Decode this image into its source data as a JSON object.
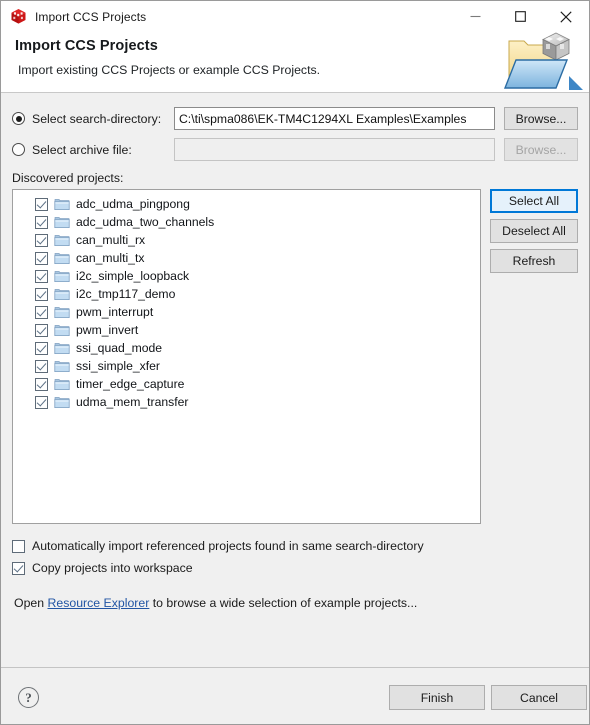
{
  "window": {
    "title": "Import CCS Projects",
    "icon": "ccs-cube-icon",
    "controls": {
      "minimize": "minimize-icon",
      "maximize": "maximize-icon",
      "close": "close-icon"
    }
  },
  "header": {
    "title": "Import CCS Projects",
    "subtitle": "Import existing CCS Projects or example CCS Projects.",
    "art": "import-projects-banner-icon"
  },
  "source": {
    "search_directory": {
      "label": "Select search-directory:",
      "selected": true,
      "value": "C:\\ti\\spma086\\EK-TM4C1294XL Examples\\Examples",
      "browse_label": "Browse...",
      "browse_enabled": true
    },
    "archive_file": {
      "label": "Select archive file:",
      "selected": false,
      "value": "",
      "placeholder": "",
      "browse_label": "Browse...",
      "browse_enabled": false
    }
  },
  "discovered": {
    "label": "Discovered projects:",
    "projects": [
      {
        "name": "adc_udma_pingpong",
        "checked": true
      },
      {
        "name": "adc_udma_two_channels",
        "checked": true
      },
      {
        "name": "can_multi_rx",
        "checked": true
      },
      {
        "name": "can_multi_tx",
        "checked": true
      },
      {
        "name": "i2c_simple_loopback",
        "checked": true
      },
      {
        "name": "i2c_tmp117_demo",
        "checked": true
      },
      {
        "name": "pwm_interrupt",
        "checked": true
      },
      {
        "name": "pwm_invert",
        "checked": true
      },
      {
        "name": "ssi_quad_mode",
        "checked": true
      },
      {
        "name": "ssi_simple_xfer",
        "checked": true
      },
      {
        "name": "timer_edge_capture",
        "checked": true
      },
      {
        "name": "udma_mem_transfer",
        "checked": true
      }
    ],
    "buttons": {
      "select_all": "Select All",
      "deselect_all": "Deselect All",
      "refresh": "Refresh",
      "focused": "select_all"
    }
  },
  "options": [
    {
      "label": "Automatically import referenced projects found in same search-directory",
      "checked": false
    },
    {
      "label": "Copy projects into workspace",
      "checked": true
    }
  ],
  "open_line": {
    "prefix": "Open ",
    "link": "Resource Explorer",
    "suffix": " to browse a wide selection of example projects..."
  },
  "footer": {
    "help": "?",
    "finish": "Finish",
    "cancel": "Cancel"
  },
  "colors": {
    "accent": "#0078d7",
    "link": "#2255a4",
    "dialog_bg": "#f0f0f0",
    "field_bg": "#ffffff",
    "brand_red": "#cc0000"
  }
}
